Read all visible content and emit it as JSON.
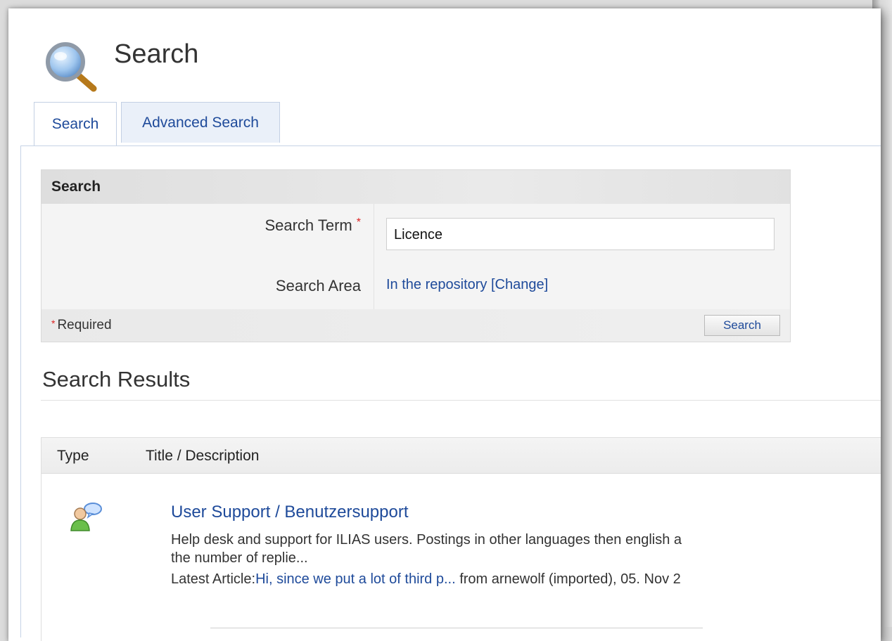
{
  "page": {
    "title": "Search"
  },
  "tabs": [
    {
      "label": "Search",
      "active": true
    },
    {
      "label": "Advanced Search",
      "active": false
    }
  ],
  "search_form": {
    "header": "Search",
    "term_label": "Search Term",
    "term_value": "Licence",
    "area_label": "Search Area",
    "area_value": "In the repository [Change]",
    "required_note": "Required",
    "button_label": "Search"
  },
  "results": {
    "title": "Search Results",
    "columns": [
      "Type",
      "Title / Description"
    ],
    "items": [
      {
        "icon": "forum-users-icon",
        "title": "User Support / Benutzersupport",
        "description_line1": "Help desk and support for ILIAS users. Postings in other languages then english a",
        "description_line2": "the number of replie...",
        "latest_label": "Latest Article:",
        "latest_link": "Hi, since we put a lot of third p...",
        "latest_suffix": " from arnewolf (imported), 05. Nov 2"
      }
    ]
  }
}
